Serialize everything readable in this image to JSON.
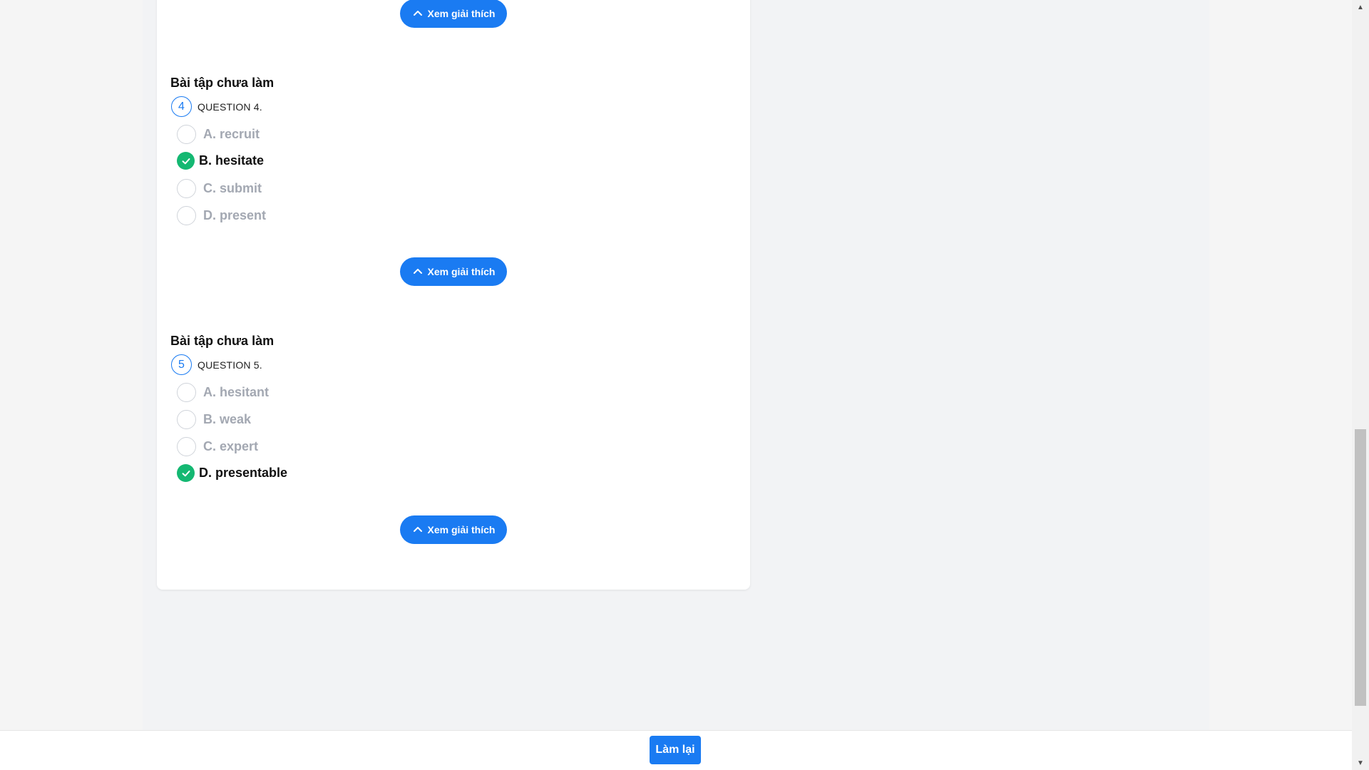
{
  "explain_label": "Xem giải thích",
  "questions": [
    {
      "section_title": "Bài tập chưa làm",
      "number": "4",
      "label": "QUESTION 4.",
      "options": [
        {
          "text": "A. recruit",
          "correct": false
        },
        {
          "text": "B. hesitate",
          "correct": true
        },
        {
          "text": "C. submit",
          "correct": false
        },
        {
          "text": "D. present",
          "correct": false
        }
      ]
    },
    {
      "section_title": "Bài tập chưa làm",
      "number": "5",
      "label": "QUESTION 5.",
      "options": [
        {
          "text": "A. hesitant",
          "correct": false
        },
        {
          "text": "B. weak",
          "correct": false
        },
        {
          "text": "C. expert",
          "correct": false
        },
        {
          "text": "D. presentable",
          "correct": true
        }
      ]
    }
  ],
  "footer": {
    "redo_label": "Làm lại"
  },
  "colors": {
    "primary": "#1a7bf2",
    "correct": "#14b872",
    "muted": "#a3a8b2"
  }
}
